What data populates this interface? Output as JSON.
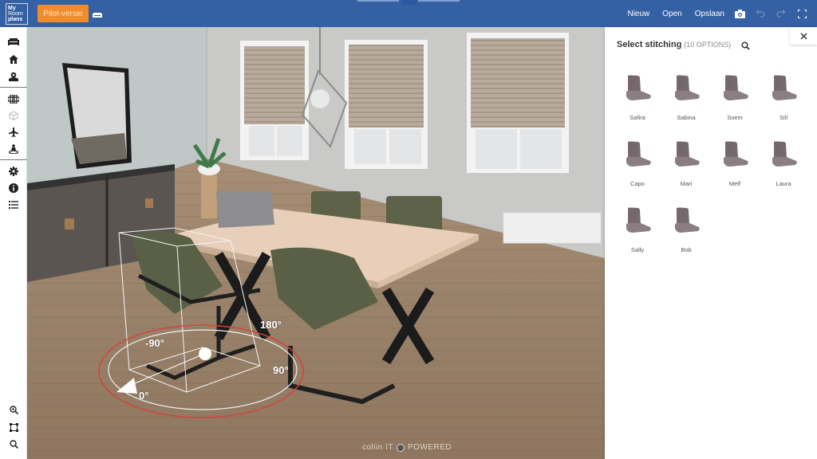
{
  "app": {
    "logo_lines": [
      "My",
      "Room",
      "plans"
    ],
    "pilot_label": "Pilot-versie"
  },
  "topbar": {
    "actions": [
      {
        "label": "Nieuw"
      },
      {
        "label": "Open"
      },
      {
        "label": "Opslaan"
      }
    ],
    "icons": [
      "camera-icon",
      "undo-icon",
      "redo-icon",
      "fullscreen-icon"
    ]
  },
  "sidebar": {
    "groups": [
      [
        "sofa-icon",
        "home-icon",
        "location-icon"
      ],
      [
        "floorplan-icon",
        "cube-icon",
        "airplane-icon",
        "person-icon"
      ],
      [
        "gear-icon",
        "info-icon",
        "list-icon"
      ]
    ],
    "bottom": [
      "zoom-in-icon",
      "fit-view-icon",
      "zoom-out-icon"
    ]
  },
  "viewport": {
    "rotation_labels": [
      "-90°",
      "180°",
      "90°",
      "0°"
    ],
    "powered_brand": "coliin IT",
    "powered_text": "POWERED"
  },
  "panel": {
    "title": "Select stitching",
    "count": "(10 OPTIONS)",
    "options": [
      {
        "label": "Safira"
      },
      {
        "label": "Sabina"
      },
      {
        "label": "Soem"
      },
      {
        "label": "Sill"
      },
      {
        "label": "Capo"
      },
      {
        "label": "Mari"
      },
      {
        "label": "Melf"
      },
      {
        "label": "Laura"
      },
      {
        "label": "Sally"
      },
      {
        "label": "Bob"
      }
    ]
  },
  "colors": {
    "topbar": "#3560a3",
    "accent_orange": "#ef8d2c",
    "rotation_ring": "#d8413a"
  }
}
